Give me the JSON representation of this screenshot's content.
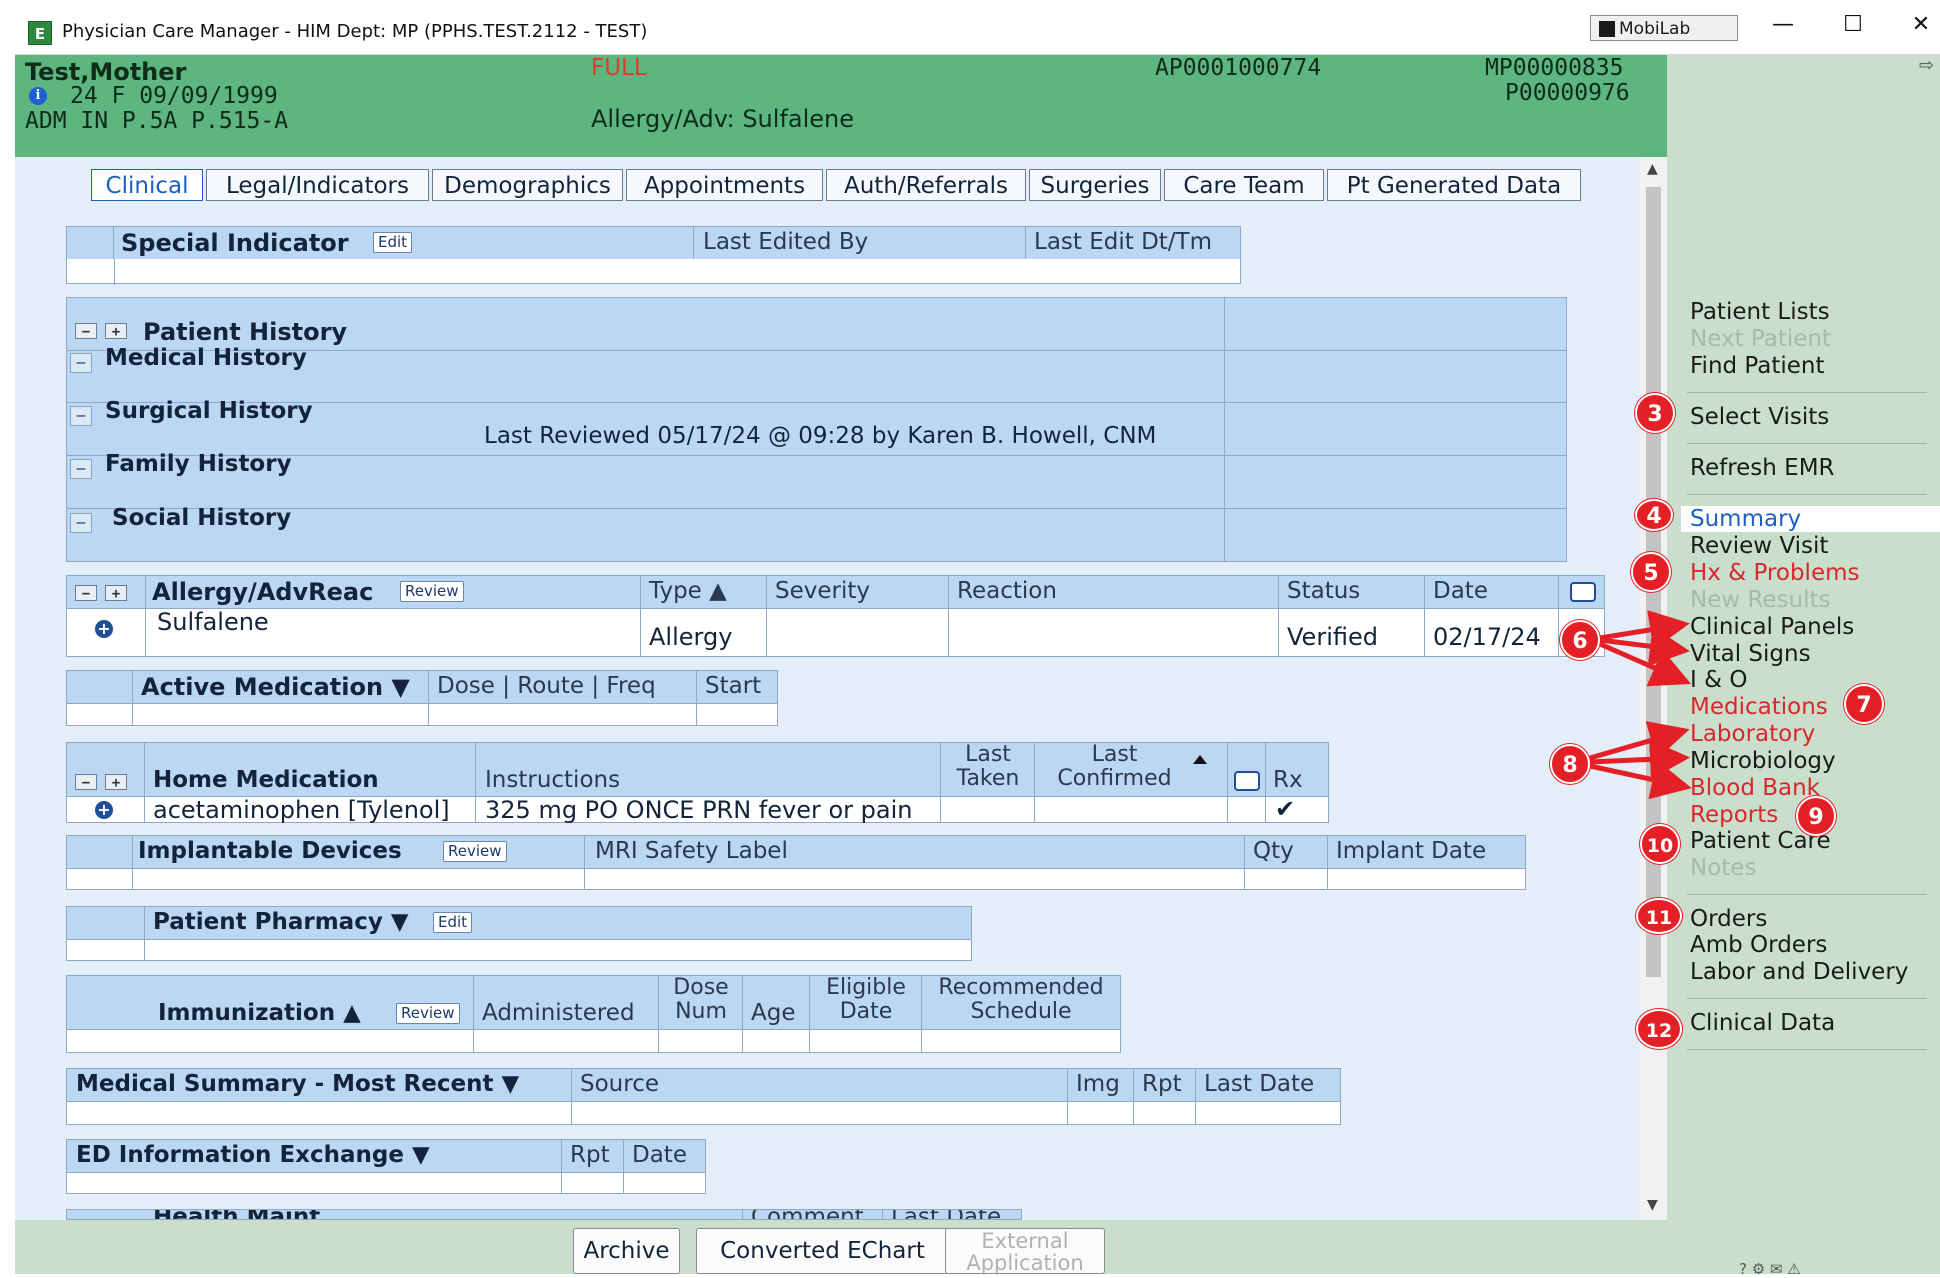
{
  "window": {
    "title": "Physician Care Manager - HIM Dept: MP (PPHS.TEST.2112 - TEST)",
    "mobilab_label": "MobiLab",
    "min_glyph": "—",
    "max_glyph": "☐",
    "close_glyph": "✕"
  },
  "patient": {
    "name": "Test,Mother",
    "demographics": "24  F  09/09/1999",
    "admission": "ADM IN  P.5A  P.515-A",
    "code_status": "FULL",
    "allergy_summary": "Allergy/Adv: Sulfalene",
    "account": "AP0001000774",
    "mrn": "MP00000835",
    "pnum": "P00000976"
  },
  "tabs": [
    "Clinical",
    "Legal/Indicators",
    "Demographics",
    "Appointments",
    "Auth/Referrals",
    "Surgeries",
    "Care Team",
    "Pt Generated Data"
  ],
  "special_indicator": {
    "title": "Special Indicator",
    "edit": "Edit",
    "col_last_edited_by": "Last Edited By",
    "col_last_edit_dt": "Last Edit Dt/Tm"
  },
  "patient_history": {
    "title": "Patient History",
    "rows": [
      "Medical History",
      "Surgical History",
      "Family History",
      "Social History"
    ],
    "last_reviewed": "Last Reviewed 05/17/24 @ 09:28 by Karen B. Howell, CNM"
  },
  "allergy": {
    "title": "Allergy/AdvReac",
    "review": "Review",
    "cols": {
      "type": "Type ▲",
      "severity": "Severity",
      "reaction": "Reaction",
      "status": "Status",
      "date": "Date"
    },
    "row": {
      "name": "Sulfalene",
      "type": "Allergy",
      "severity": "",
      "reaction": "",
      "status": "Verified",
      "date": "02/17/24"
    }
  },
  "active_med": {
    "title": "Active Medication ▼",
    "cols": "Dose | Route | Freq",
    "start": "Start"
  },
  "home_med": {
    "title": "Home Medication",
    "cols": {
      "instructions": "Instructions",
      "last_taken": "Last\nTaken",
      "last_confirmed": "Last\nConfirmed",
      "rx": "Rx"
    },
    "row": {
      "name": "acetaminophen [Tylenol]",
      "instructions": "325 mg PO ONCE PRN fever or pain",
      "rx": "✔"
    }
  },
  "implant": {
    "title": "Implantable Devices",
    "review": "Review",
    "col_mri": "MRI Safety Label",
    "col_qty": "Qty",
    "col_date": "Implant Date"
  },
  "pharmacy": {
    "title": "Patient Pharmacy ▼",
    "edit": "Edit"
  },
  "immunization": {
    "title": "Immunization ▲",
    "review": "Review",
    "cols": [
      "Administered",
      "Dose\nNum",
      "Age",
      "Eligible\nDate",
      "Recommended\nSchedule"
    ]
  },
  "med_summary": {
    "title": "Medical Summary - Most Recent ▼",
    "cols": [
      "Source",
      "Img",
      "Rpt",
      "Last Date"
    ]
  },
  "ed_info": {
    "title": "ED Information Exchange ▼",
    "cols": [
      "Rpt",
      "Date"
    ]
  },
  "health_maint": {
    "title": "Health Maint",
    "cols": [
      "Comment",
      "Last Date"
    ]
  },
  "nav": {
    "expand": "⇨",
    "items": [
      {
        "label": "Patient Lists",
        "state": "normal"
      },
      {
        "label": "Next Patient",
        "state": "disabled"
      },
      {
        "label": "Find Patient",
        "state": "normal"
      },
      {
        "label": "Select Visits",
        "state": "normal"
      },
      {
        "label": "Refresh EMR",
        "state": "normal"
      },
      {
        "label": "Summary",
        "state": "selected"
      },
      {
        "label": "Review Visit",
        "state": "normal"
      },
      {
        "label": "Hx & Problems",
        "state": "red"
      },
      {
        "label": "New Results",
        "state": "disabled"
      },
      {
        "label": "Clinical Panels",
        "state": "normal"
      },
      {
        "label": "Vital Signs",
        "state": "normal"
      },
      {
        "label": "I & O",
        "state": "normal"
      },
      {
        "label": "Medications",
        "state": "red"
      },
      {
        "label": "Laboratory",
        "state": "red"
      },
      {
        "label": "Microbiology",
        "state": "normal"
      },
      {
        "label": "Blood Bank",
        "state": "red"
      },
      {
        "label": "Reports",
        "state": "red"
      },
      {
        "label": "Patient Care",
        "state": "normal"
      },
      {
        "label": "Notes",
        "state": "disabled"
      },
      {
        "label": "Orders",
        "state": "normal"
      },
      {
        "label": "Amb Orders",
        "state": "normal"
      },
      {
        "label": "Labor and Delivery",
        "state": "normal"
      },
      {
        "label": "Clinical Data",
        "state": "normal"
      }
    ],
    "badges": [
      "3",
      "4",
      "5",
      "6",
      "7",
      "8",
      "9",
      "10",
      "11",
      "12"
    ]
  },
  "bottom": {
    "archive": "Archive",
    "echart": "Converted EChart",
    "external": "External Application"
  },
  "colors": {
    "header_green": "#5db57f",
    "nav_green": "#c9dfcb",
    "table_header": "#bcd7f3",
    "alert_red": "#e41f26"
  }
}
